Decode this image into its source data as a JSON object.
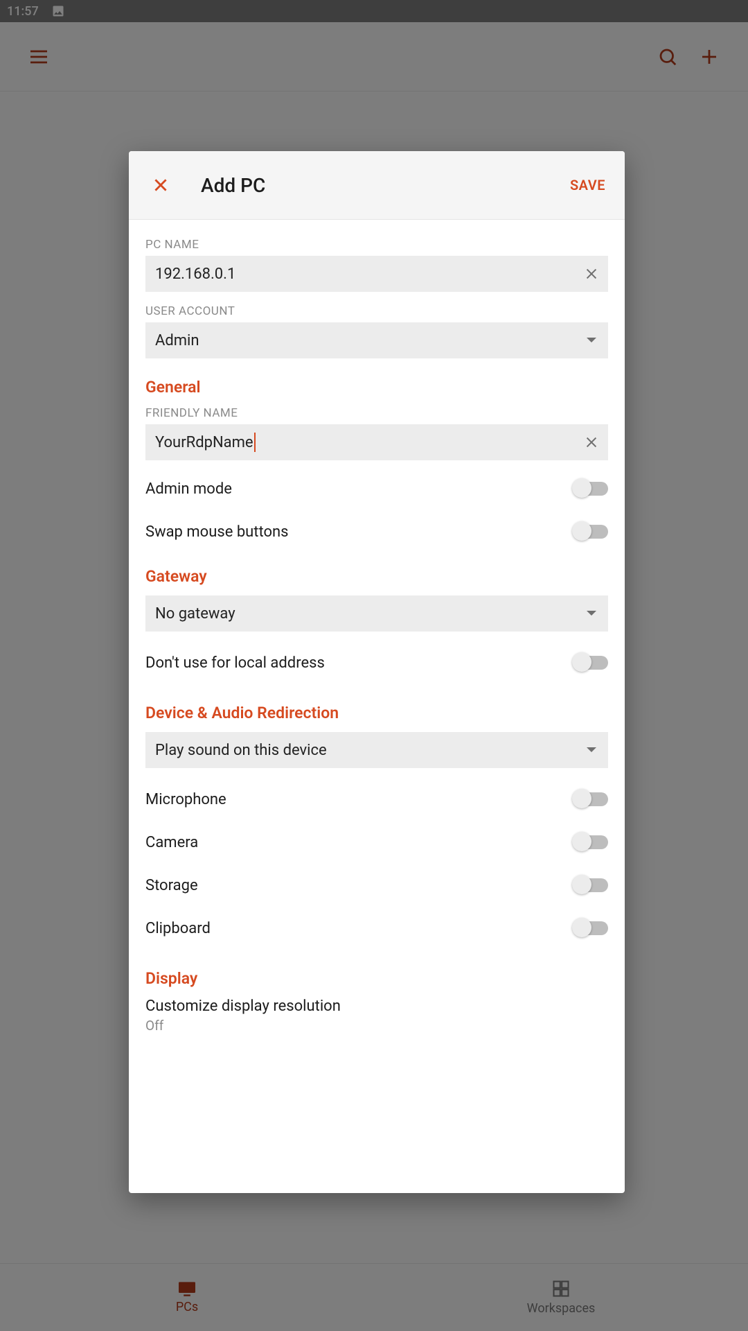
{
  "status_bar": {
    "time": "11:57"
  },
  "app_bar": {
    "tabs": {
      "pcs": "PCs",
      "workspaces": "Workspaces"
    }
  },
  "dialog": {
    "title": "Add PC",
    "save_label": "SAVE",
    "fields": {
      "pc_name_label": "PC NAME",
      "pc_name_value": "192.168.0.1",
      "user_account_label": "USER ACCOUNT",
      "user_account_value": "Admin"
    },
    "sections": {
      "general": {
        "title": "General",
        "friendly_name_label": "FRIENDLY NAME",
        "friendly_name_value": "YourRdpName",
        "admin_mode_label": "Admin mode",
        "swap_mouse_label": "Swap mouse buttons"
      },
      "gateway": {
        "title": "Gateway",
        "value": "No gateway",
        "dont_use_local_label": "Don't use for local address"
      },
      "device_audio": {
        "title": "Device & Audio Redirection",
        "sound_value": "Play sound on this device",
        "microphone_label": "Microphone",
        "camera_label": "Camera",
        "storage_label": "Storage",
        "clipboard_label": "Clipboard"
      },
      "display": {
        "title": "Display",
        "customize_label": "Customize display resolution",
        "customize_value": "Off"
      }
    }
  }
}
